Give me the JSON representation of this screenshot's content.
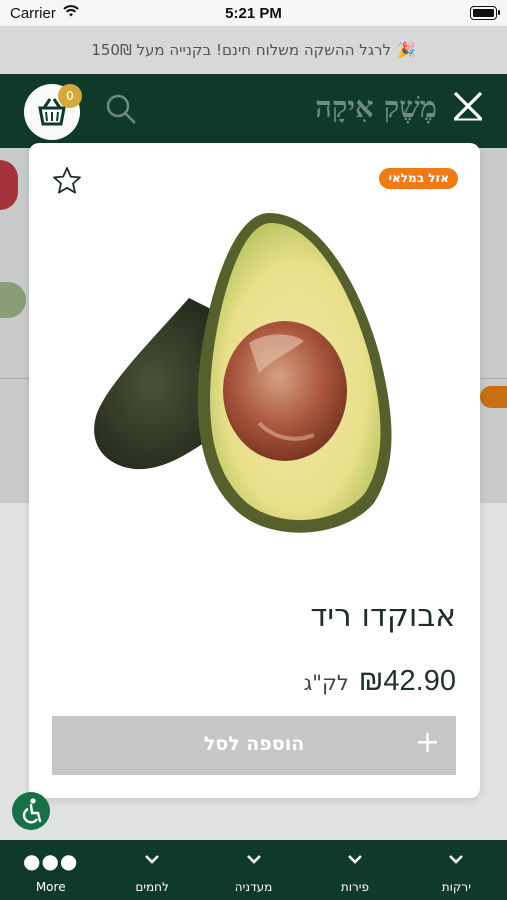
{
  "status_bar": {
    "carrier": "Carrier",
    "time": "5:21 PM"
  },
  "promo": {
    "text": "לרגל ההשקה משלוח חינם! בקנייה מעל 150₪",
    "emoji": "🎉"
  },
  "header": {
    "brand": "מֶשֶׁק אִיקָה",
    "cart_count": "0"
  },
  "product": {
    "sale_tag": "אזל במלאי",
    "name": "אבוקדו ריד",
    "price": "₪42.90",
    "unit": "לק\"ג",
    "add_button_label": "הוספה לסל",
    "add_button_symbol": "+"
  },
  "tabs": [
    {
      "label": "More",
      "icon": "more-icon"
    },
    {
      "label": "לחמים",
      "icon": "chevron-down-icon"
    },
    {
      "label": "מעדניה",
      "icon": "chevron-down-icon"
    },
    {
      "label": "פירות",
      "icon": "chevron-down-icon"
    },
    {
      "label": "ירקות",
      "icon": "chevron-down-icon"
    }
  ],
  "colors": {
    "brand_dark": "#0f3a2a",
    "sale_orange": "#f07a16",
    "accessibility_green": "#187048",
    "disabled_button": "#c5c7c6"
  }
}
